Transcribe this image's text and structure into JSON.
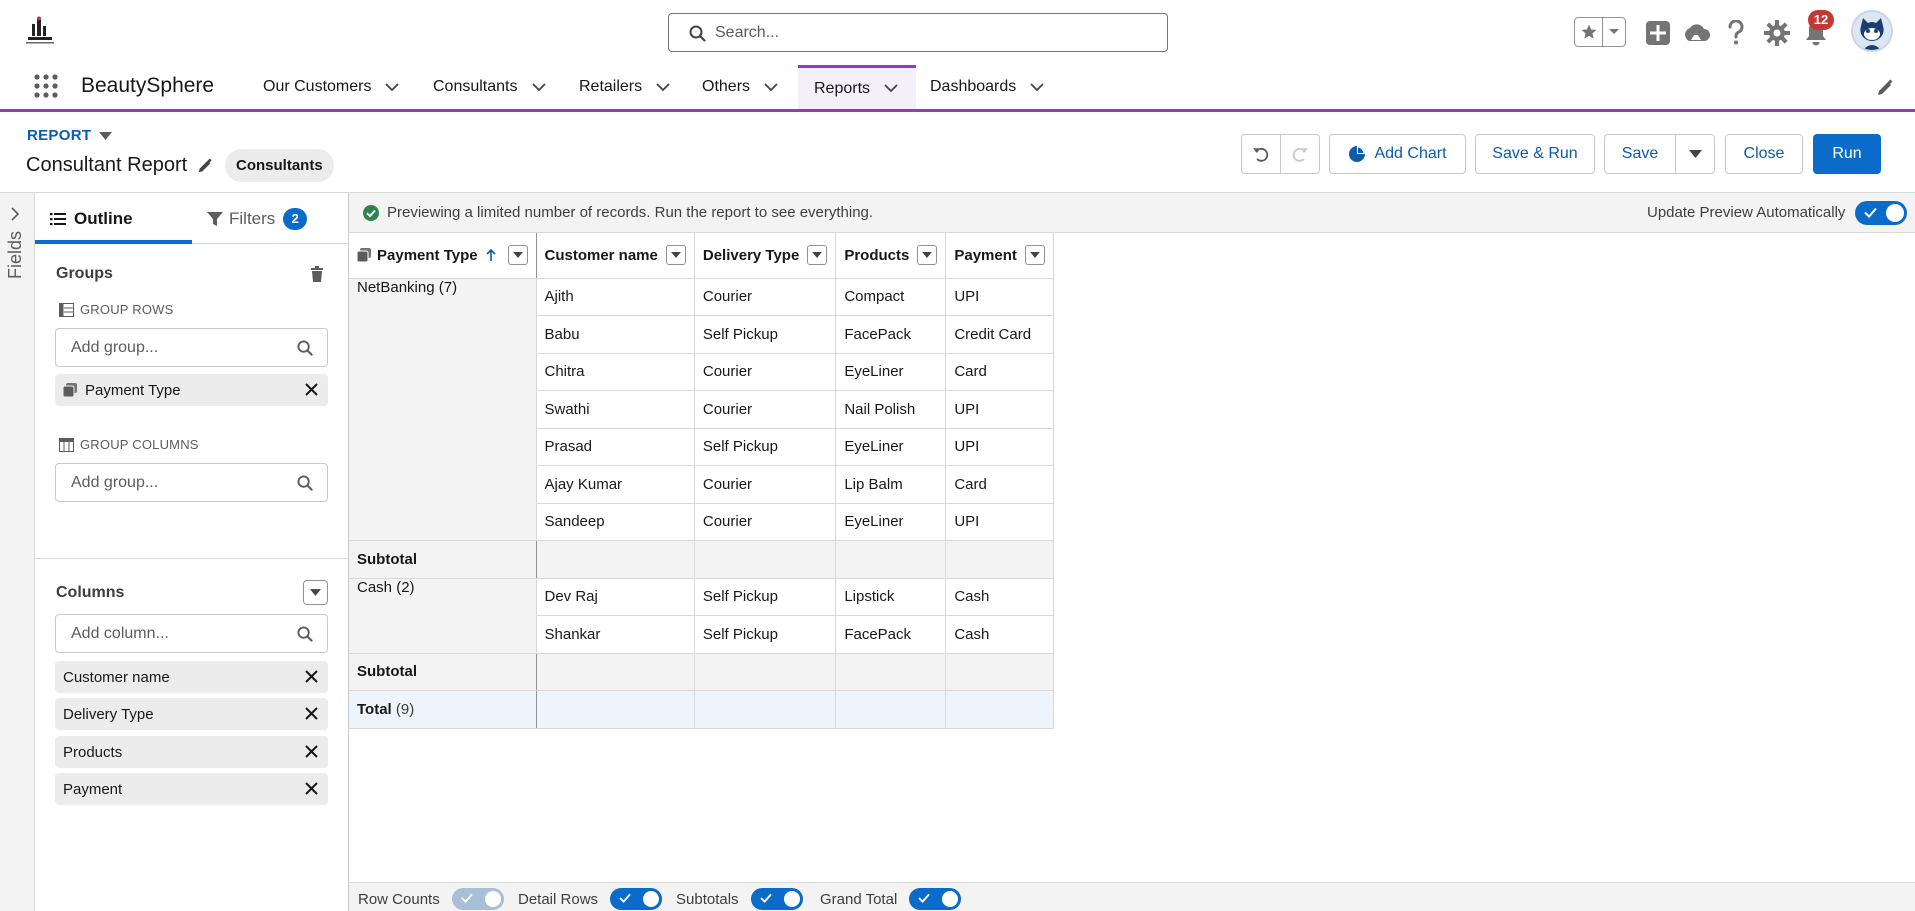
{
  "header": {
    "search_placeholder": "Search...",
    "notification_count": "12"
  },
  "nav": {
    "app_name": "BeautySphere",
    "items": [
      {
        "label": "Our Customers"
      },
      {
        "label": "Consultants"
      },
      {
        "label": "Retailers"
      },
      {
        "label": "Others"
      },
      {
        "label": "Reports",
        "active": true
      },
      {
        "label": "Dashboards"
      }
    ]
  },
  "report": {
    "type_label": "REPORT",
    "title": "Consultant Report",
    "report_type_pill": "Consultants",
    "buttons": {
      "add_chart": "Add Chart",
      "save_run": "Save & Run",
      "save": "Save",
      "close": "Close",
      "run": "Run"
    }
  },
  "fields_rail": {
    "label": "Fields"
  },
  "outline": {
    "tab_outline": "Outline",
    "tab_filters": "Filters",
    "filter_count": "2",
    "groups_title": "Groups",
    "group_rows_label": "GROUP ROWS",
    "group_rows_placeholder": "Add group...",
    "group_rows_items": [
      "Payment Type"
    ],
    "group_columns_label": "GROUP COLUMNS",
    "group_columns_placeholder": "Add group...",
    "columns_title": "Columns",
    "columns_placeholder": "Add column...",
    "columns_items": [
      "Customer name",
      "Delivery Type",
      "Products",
      "Payment"
    ]
  },
  "preview": {
    "message": "Previewing a limited number of records. Run the report to see everything.",
    "update_label": "Update Preview Automatically",
    "update_on": true
  },
  "table": {
    "headers": [
      "Payment Type",
      "Customer name",
      "Delivery Type",
      "Products",
      "Payment"
    ],
    "groups": [
      {
        "label": "NetBanking",
        "count": "(7)",
        "rows": [
          [
            "Ajith",
            "Courier",
            "Compact",
            "UPI"
          ],
          [
            "Babu",
            "Self Pickup",
            "FacePack",
            "Credit Card"
          ],
          [
            "Chitra",
            "Courier",
            "EyeLiner",
            "Card"
          ],
          [
            "Swathi",
            "Courier",
            "Nail Polish",
            "UPI"
          ],
          [
            "Prasad",
            "Self Pickup",
            "EyeLiner",
            "UPI"
          ],
          [
            "Ajay Kumar",
            "Courier",
            "Lip Balm",
            "Card"
          ],
          [
            "Sandeep",
            "Courier",
            "EyeLiner",
            "UPI"
          ]
        ]
      },
      {
        "label": "Cash",
        "count": "(2)",
        "rows": [
          [
            "Dev Raj",
            "Self Pickup",
            "Lipstick",
            "Cash"
          ],
          [
            "Shankar",
            "Self Pickup",
            "FacePack",
            "Cash"
          ]
        ]
      }
    ],
    "subtotal_label": "Subtotal",
    "total_label": "Total",
    "total_count": "(9)"
  },
  "footer": {
    "row_counts": "Row Counts",
    "detail_rows": "Detail Rows",
    "subtotals": "Subtotals",
    "grand_total": "Grand Total",
    "row_counts_on": false,
    "detail_rows_on": true,
    "subtotals_on": true,
    "grand_total_on": true
  }
}
